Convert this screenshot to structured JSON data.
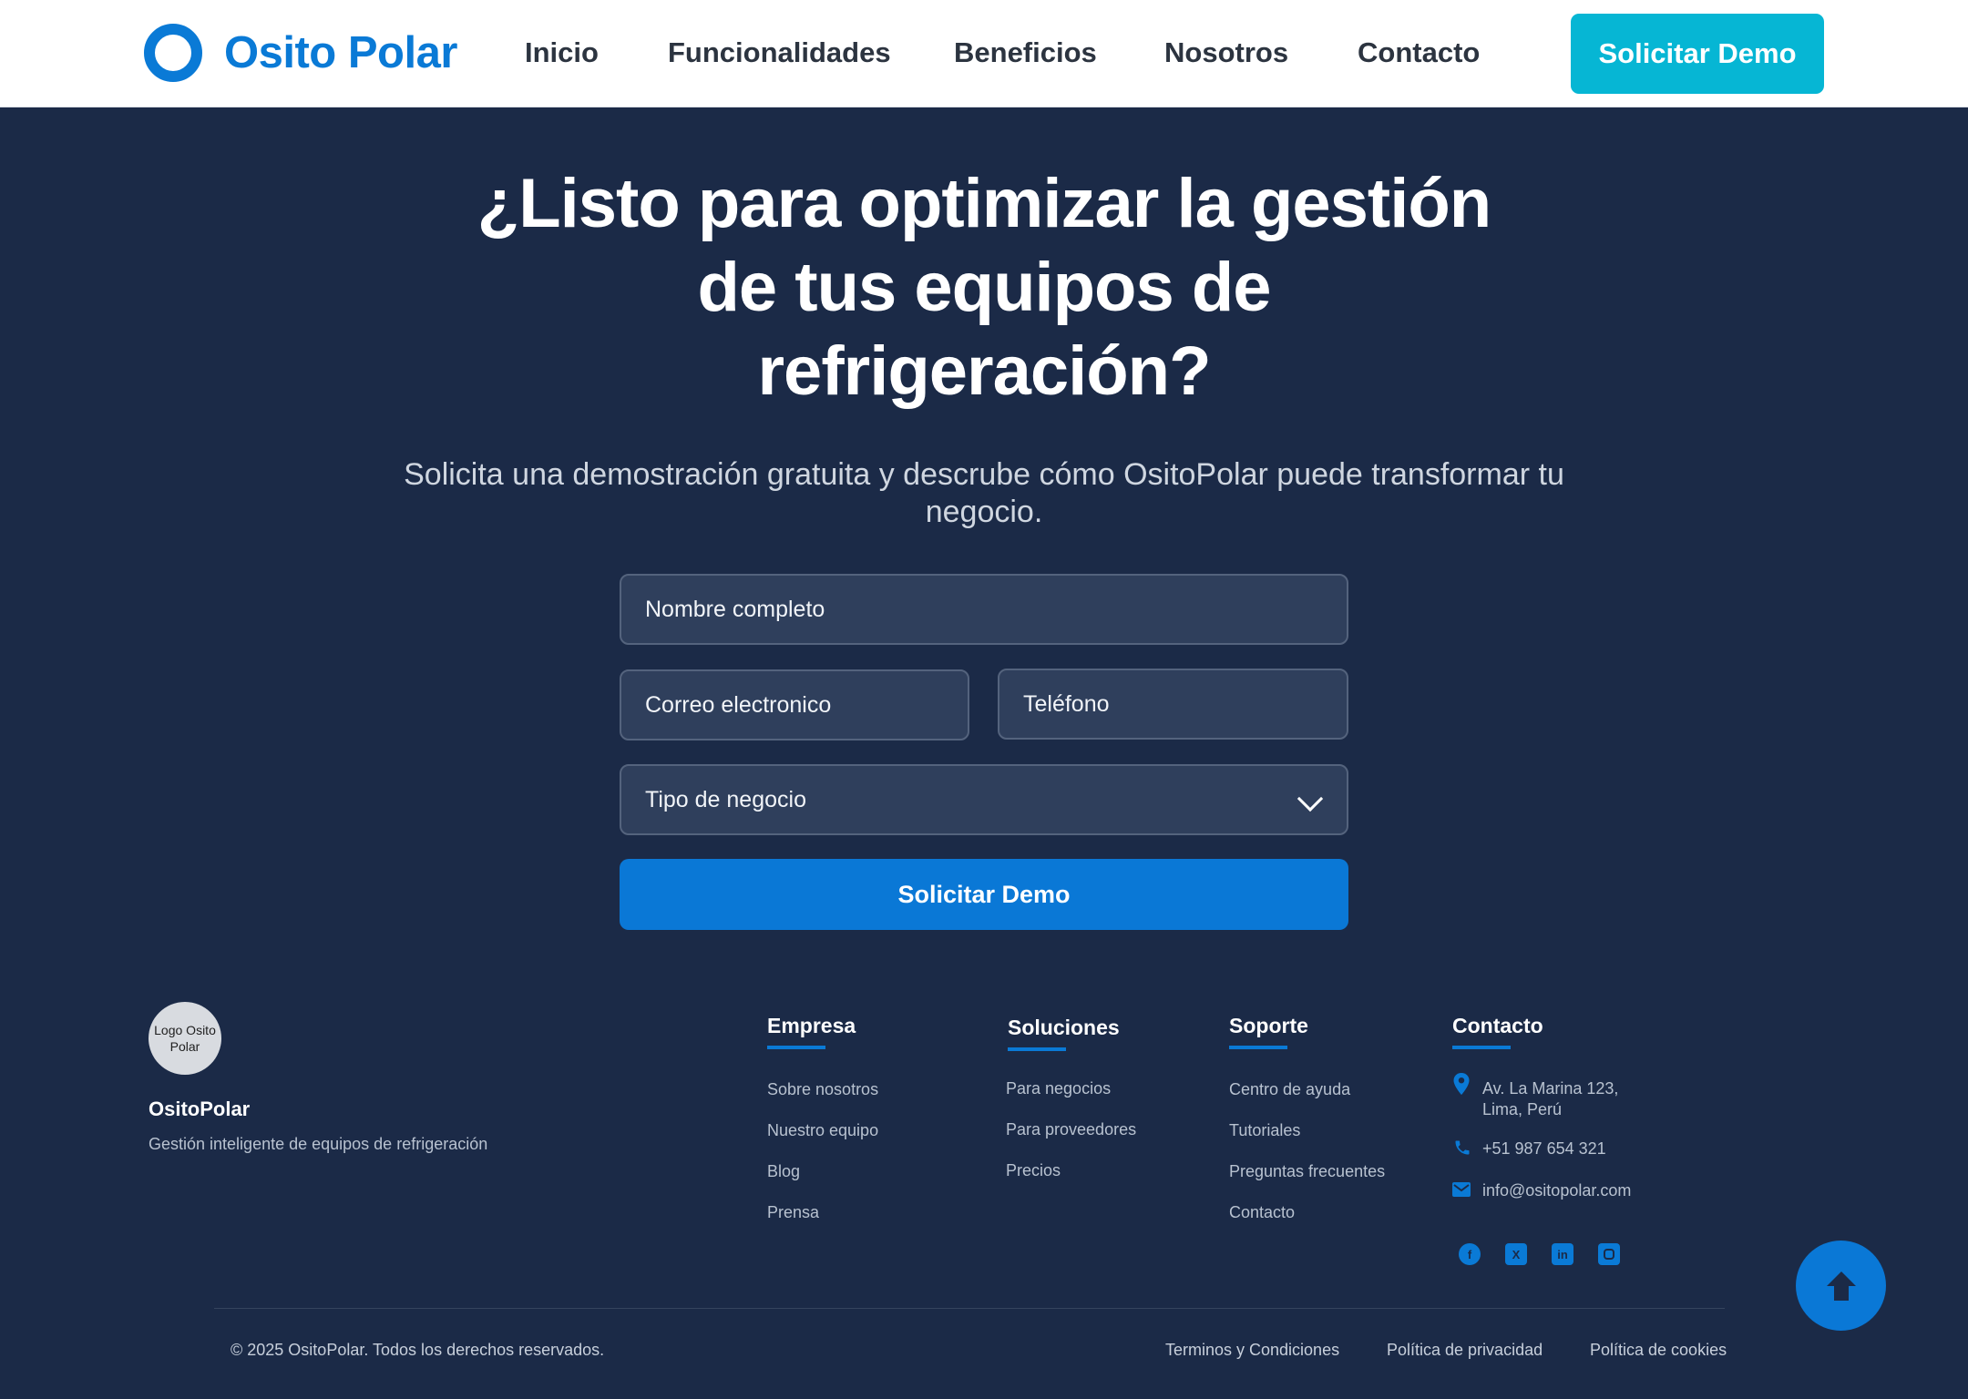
{
  "brand": {
    "name": "Osito Polar",
    "accent_color": "#0a7ad6",
    "cta_color": "#06b6d4"
  },
  "nav": {
    "items": [
      "Inicio",
      "Funcionalidades",
      "Beneficios",
      "Nosotros",
      "Contacto"
    ],
    "cta_label": "Solicitar Demo"
  },
  "hero": {
    "title_line1": "¿Listo para optimizar la gestión",
    "title_line2": "de tus equipos de",
    "title_line3": "refrigeración?",
    "subtitle": "Solicita una demostración gratuita y descrube cómo OsitoPolar puede transformar tu negocio."
  },
  "form": {
    "name_placeholder": "Nombre completo",
    "email_placeholder": "Correo electronico",
    "phone_placeholder": "Teléfono",
    "business_type_selected": "Tipo de negocio",
    "submit_label": "Solicitar Demo"
  },
  "footer": {
    "logo_text": "Logo Osito Polar",
    "brand_name": "OsitoPolar",
    "tagline": "Gestión inteligente de equipos de refrigeración",
    "columns": [
      {
        "title": "Empresa",
        "links": [
          "Sobre nosotros",
          "Nuestro equipo",
          "Blog",
          "Prensa"
        ]
      },
      {
        "title": "Soluciones",
        "links": [
          "Para negocios",
          "Para proveedores",
          "Precios"
        ]
      },
      {
        "title": "Soporte",
        "links": [
          "Centro de ayuda",
          "Tutoriales",
          "Preguntas frecuentes",
          "Contacto"
        ]
      }
    ],
    "contact": {
      "title": "Contacto",
      "address_line1": "Av. La Marina 123,",
      "address_line2": "Lima, Perú",
      "phone": "+51 987 654 321",
      "email": "info@ositopolar.com",
      "socials": [
        "facebook-icon",
        "x-icon",
        "linkedin-icon",
        "instagram-icon"
      ]
    },
    "copyright": "© 2025 OsitoPolar. Todos los derechos reservados.",
    "legal_links": [
      "Terminos y Condiciones",
      "Política de privacidad",
      "Política de cookies"
    ]
  }
}
